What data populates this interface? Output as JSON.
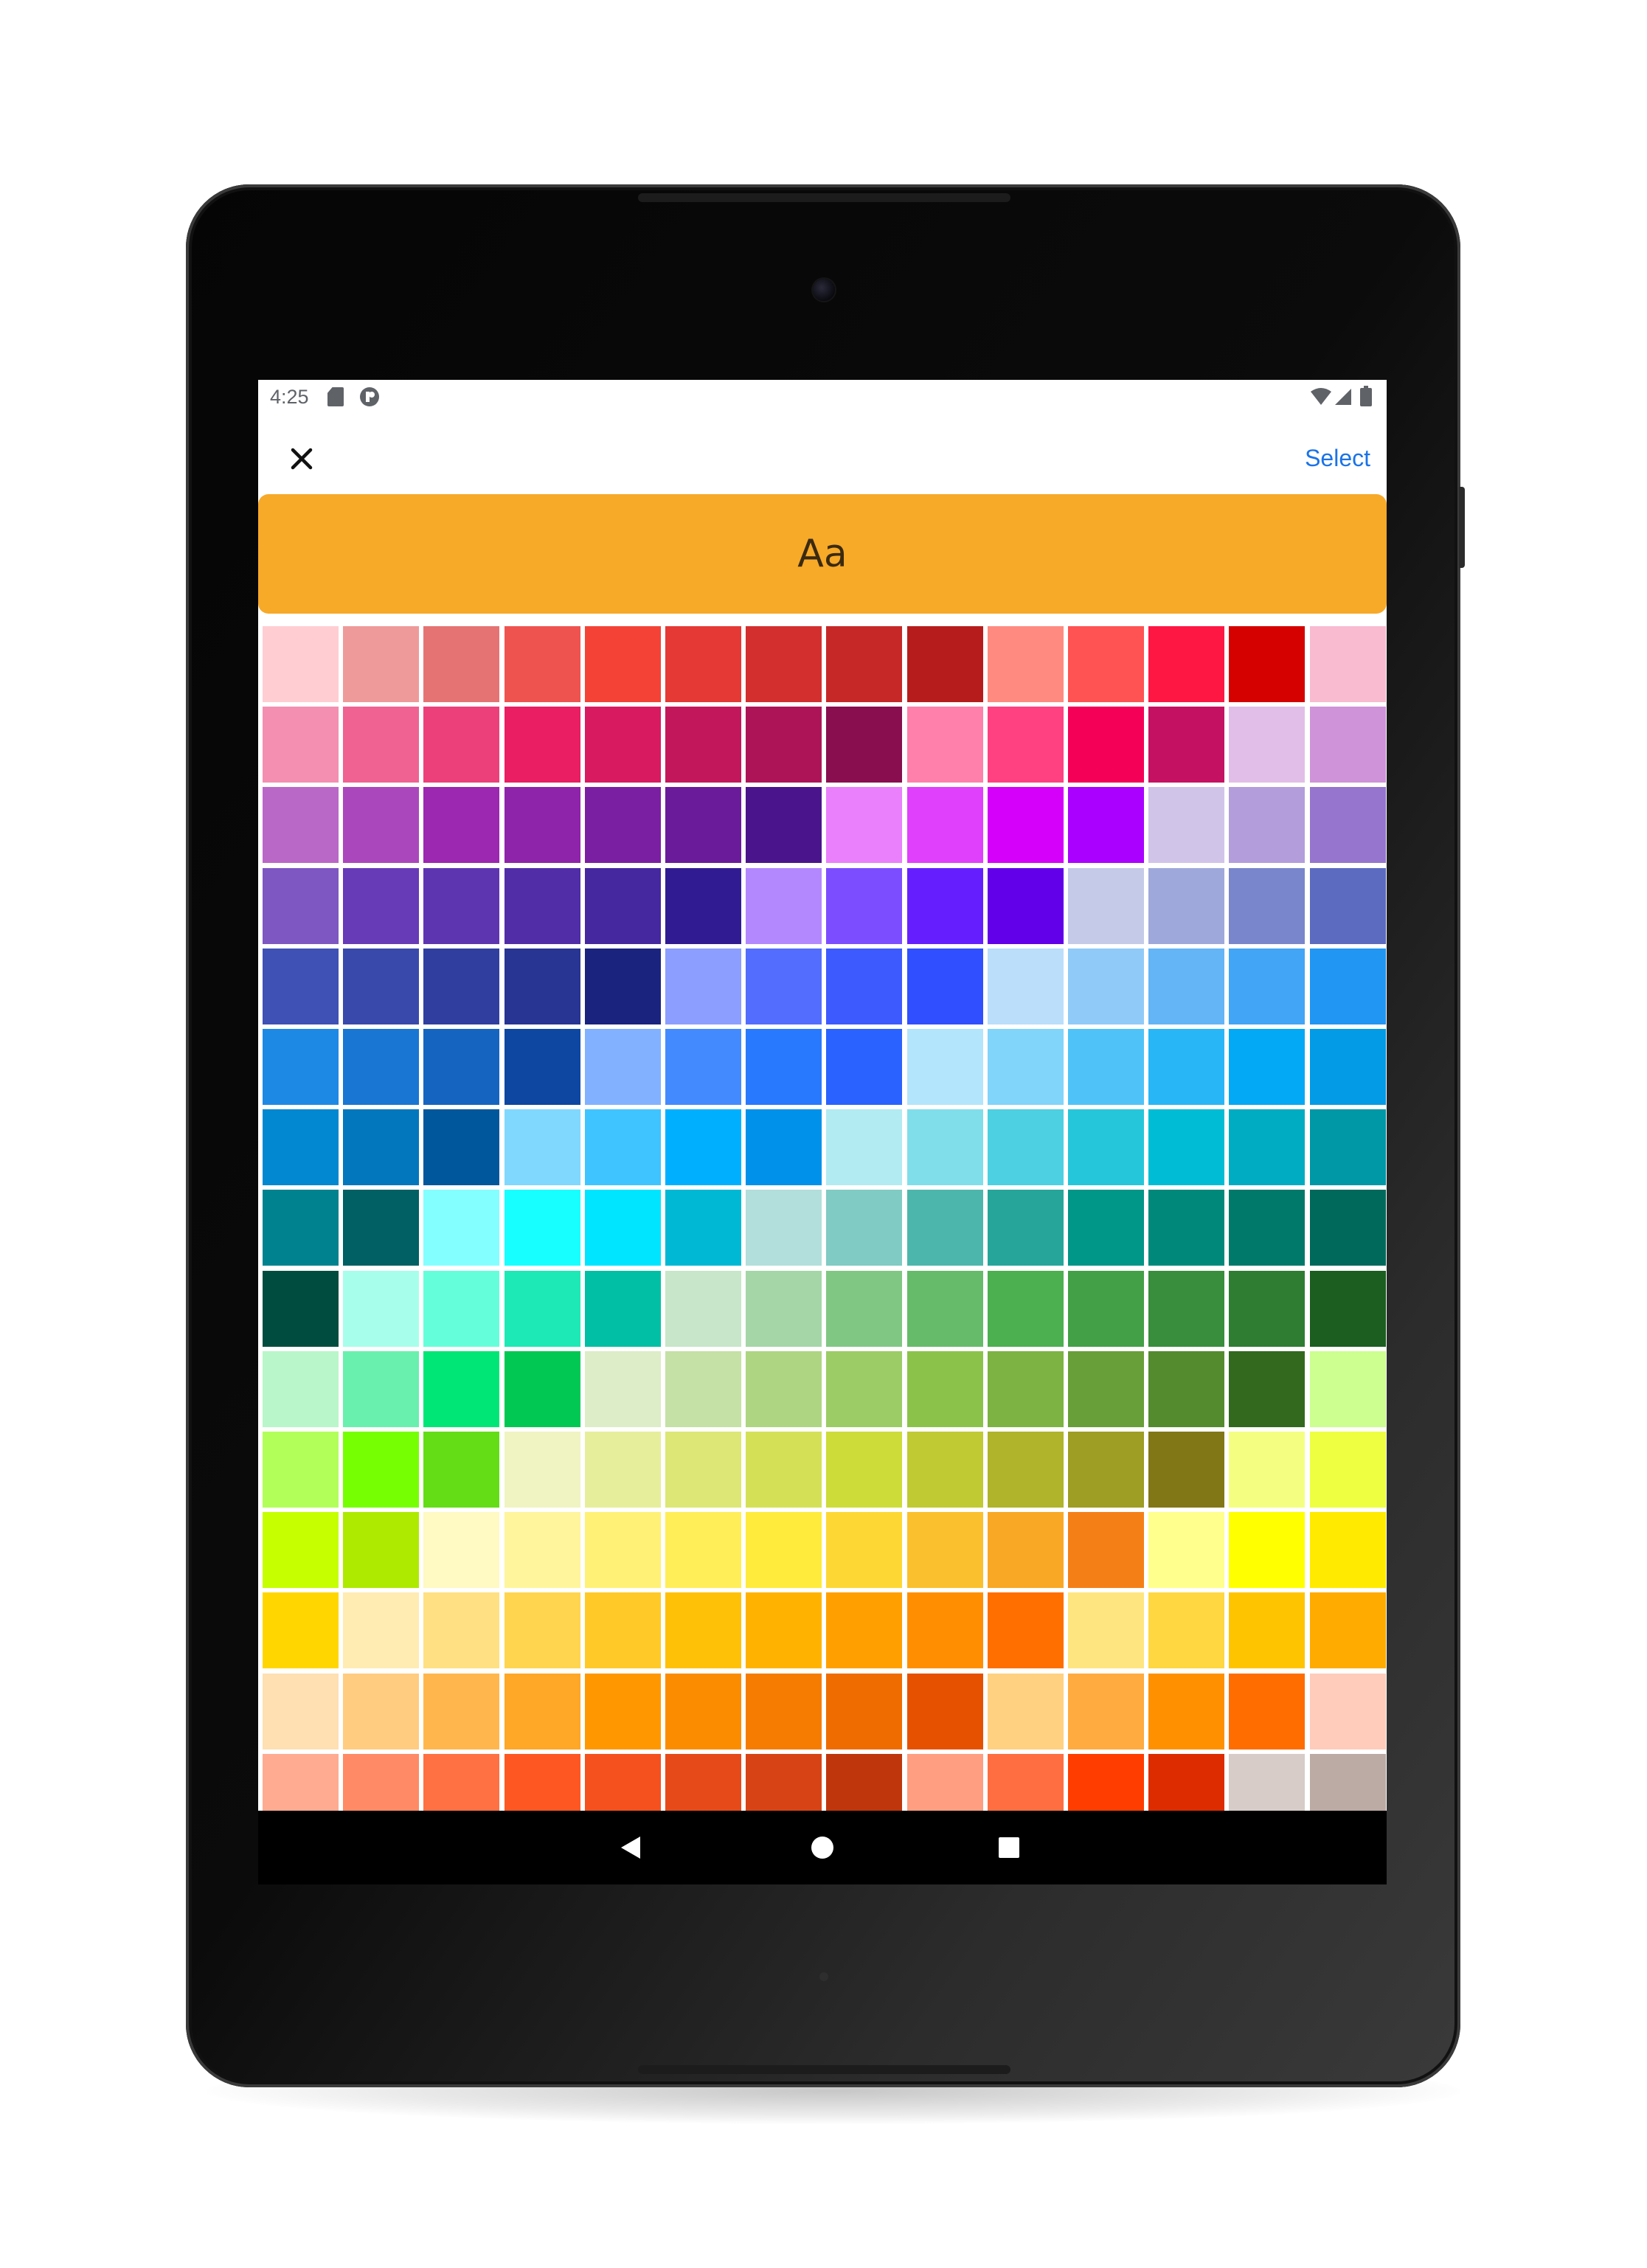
{
  "status_bar": {
    "time": "4:25",
    "icons": [
      "sd-card-icon",
      "app-badge-icon",
      "wifi-icon",
      "signal-icon",
      "battery-icon"
    ]
  },
  "toolbar": {
    "close_icon": "close-icon",
    "select_label": "Select",
    "accent_color": "#1a73e8"
  },
  "preview": {
    "text": "Aa",
    "background": "#f7a928"
  },
  "palette": {
    "rows": [
      [
        "#ffcdd2",
        "#ef9a9a",
        "#e57373",
        "#ef5350",
        "#f44336",
        "#e53935",
        "#d32f2f",
        "#c62828",
        "#b71c1c",
        "#ff8a80",
        "#ff5252",
        "#ff1744",
        "#d50000",
        "#f8bbd0"
      ],
      [
        "#f48fb1",
        "#f06292",
        "#ec407a",
        "#e91e63",
        "#d81b60",
        "#c2185b",
        "#ad1457",
        "#880e4f",
        "#ff80ab",
        "#ff4081",
        "#f50057",
        "#c51162",
        "#e1bee7",
        "#ce93d8"
      ],
      [
        "#ba68c8",
        "#ab47bc",
        "#9c27b0",
        "#8e24aa",
        "#7b1fa2",
        "#6a1b9a",
        "#4a148c",
        "#ea80fc",
        "#e040fb",
        "#d500f9",
        "#aa00ff",
        "#d1c4e9",
        "#b39ddb",
        "#9575cd"
      ],
      [
        "#7e57c2",
        "#673ab7",
        "#5e35b1",
        "#512da8",
        "#4527a0",
        "#311b92",
        "#b388ff",
        "#7c4dff",
        "#651fff",
        "#6200ea",
        "#c5cae9",
        "#9fa8da",
        "#7986cb",
        "#5c6bc0"
      ],
      [
        "#3f51b5",
        "#3949ab",
        "#303f9f",
        "#283593",
        "#1a237e",
        "#8c9eff",
        "#536dfe",
        "#3d5afe",
        "#304ffe",
        "#bbdefb",
        "#90caf9",
        "#64b5f6",
        "#42a5f5",
        "#2196f3"
      ],
      [
        "#1e88e5",
        "#1976d2",
        "#1565c0",
        "#0d47a1",
        "#82b1ff",
        "#448aff",
        "#2979ff",
        "#2962ff",
        "#b3e5fc",
        "#81d4fa",
        "#4fc3f7",
        "#29b6f6",
        "#03a9f4",
        "#039be5"
      ],
      [
        "#0288d1",
        "#0277bd",
        "#01579b",
        "#80d8ff",
        "#40c4ff",
        "#00b0ff",
        "#0091ea",
        "#b2ebf2",
        "#80deea",
        "#4dd0e1",
        "#26c6da",
        "#00bcd4",
        "#00acc1",
        "#0097a7"
      ],
      [
        "#00838f",
        "#006064",
        "#84ffff",
        "#18ffff",
        "#00e5ff",
        "#00b8d4",
        "#b2dfdb",
        "#80cbc4",
        "#4db6ac",
        "#26a69a",
        "#009688",
        "#00897b",
        "#00796b",
        "#00695c"
      ],
      [
        "#004d40",
        "#a7ffeb",
        "#64ffda",
        "#1de9b6",
        "#00bfa5",
        "#c8e6c9",
        "#a5d6a7",
        "#81c784",
        "#66bb6a",
        "#4caf50",
        "#43a047",
        "#388e3c",
        "#2e7d32",
        "#1b5e20"
      ],
      [
        "#b9f6ca",
        "#69f0ae",
        "#00e676",
        "#00c853",
        "#dcedc8",
        "#c5e1a5",
        "#aed581",
        "#9ccc65",
        "#8bc34a",
        "#7cb342",
        "#689f38",
        "#558b2f",
        "#33691e",
        "#ccff90"
      ],
      [
        "#b2ff59",
        "#76ff03",
        "#64dd17",
        "#f0f4c3",
        "#e6ee9c",
        "#dce775",
        "#d4e157",
        "#cddc39",
        "#c0ca33",
        "#afb42b",
        "#9e9d24",
        "#827717",
        "#f4ff81",
        "#eeff41"
      ],
      [
        "#c6ff00",
        "#aeea00",
        "#fff9c4",
        "#fff59d",
        "#fff176",
        "#ffee58",
        "#ffeb3b",
        "#fdd835",
        "#fbc02d",
        "#f9a825",
        "#f57f17",
        "#ffff8d",
        "#ffff00",
        "#ffea00"
      ],
      [
        "#ffd600",
        "#ffecb3",
        "#ffe082",
        "#ffd54f",
        "#ffca28",
        "#ffc107",
        "#ffb300",
        "#ffa000",
        "#ff8f00",
        "#ff6f00",
        "#ffe57f",
        "#ffd740",
        "#ffc400",
        "#ffab00"
      ],
      [
        "#ffe0b2",
        "#ffcc80",
        "#ffb74d",
        "#ffa726",
        "#ff9800",
        "#fb8c00",
        "#f57c00",
        "#ef6c00",
        "#e65100",
        "#ffd180",
        "#ffab40",
        "#ff9100",
        "#ff6d00",
        "#ffccbc"
      ],
      [
        "#ffab91",
        "#ff8a65",
        "#ff7043",
        "#ff5722",
        "#f4511e",
        "#e64a19",
        "#d84315",
        "#bf360c",
        "#ff9e80",
        "#ff6e40",
        "#ff3d00",
        "#dd2c00",
        "#d7ccc8",
        "#bcaaa4"
      ],
      [
        "#a1887f",
        "#8d6e63",
        "#795548",
        "#6d4c41",
        "#5d4037",
        "#4e342e",
        "#3e2723",
        "#fafafa",
        "#f5f5f5",
        "#eeeeee",
        "#e0e0e0",
        "#bdbdbd",
        "#9e9e9e",
        "#757575"
      ]
    ]
  },
  "nav_bar": {
    "icons": [
      "back-icon",
      "home-icon",
      "recents-icon"
    ]
  }
}
